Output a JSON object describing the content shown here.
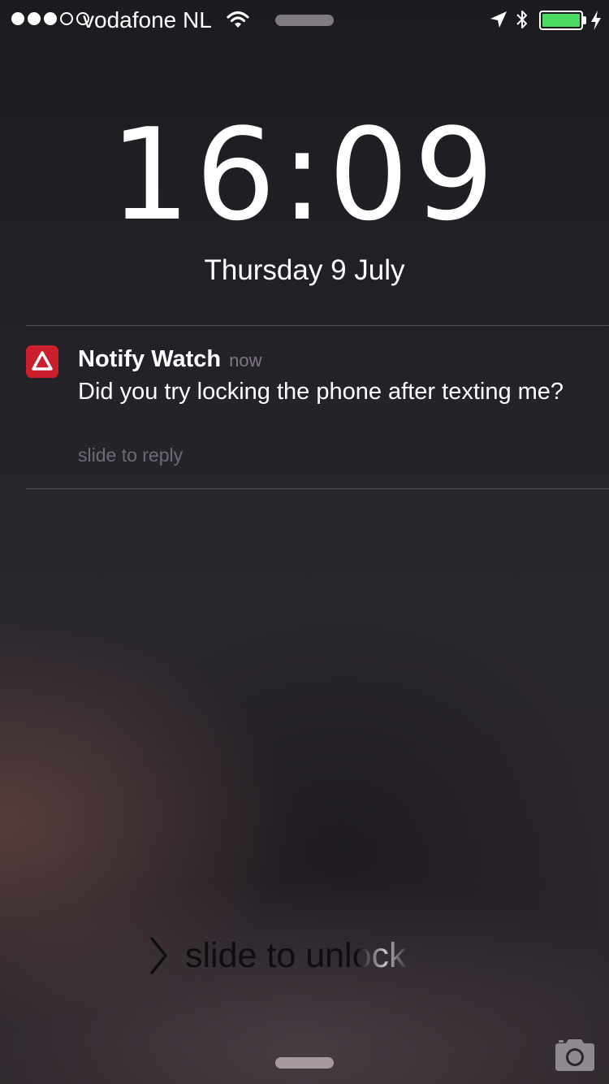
{
  "status_bar": {
    "signal": {
      "filled": 3,
      "total": 5
    },
    "carrier": "vodafone NL",
    "wifi_icon": "wifi-icon",
    "location_icon": "location-arrow-icon",
    "bluetooth_icon": "bluetooth-icon",
    "battery_level": 1.0,
    "battery_color": "#4cd964",
    "charging_icon": "lightning-bolt-icon"
  },
  "lock_screen": {
    "time": "16:09",
    "date": "Thursday 9 July"
  },
  "notification": {
    "app_icon": "warning-triangle-icon",
    "app_icon_color": "#cc1f2d",
    "app_name": "Notify Watch",
    "time": "now",
    "message": "Did you try locking the phone after texting me?",
    "action": "slide to reply"
  },
  "unlock": {
    "label": "slide to unlock",
    "chevron_icon": "chevron-right-icon"
  },
  "camera": {
    "icon": "camera-icon"
  }
}
